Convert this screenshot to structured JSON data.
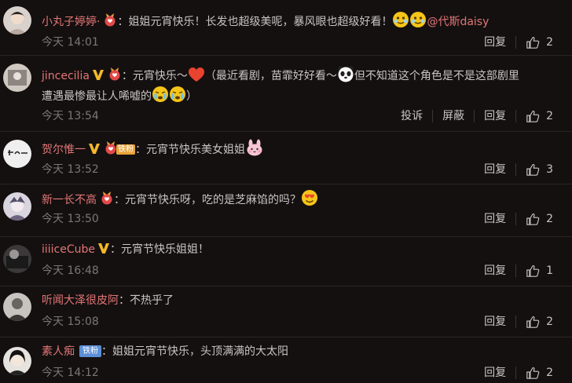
{
  "comments": [
    {
      "user": "小丸子婷婷·",
      "text": "：姐姐元宵快乐！长发也超级美呢，暴风眼也超级好看！",
      "mention": "@代斯daisy",
      "time": "今天 14:01",
      "reply": "回复",
      "likes": "2"
    },
    {
      "user": "jincecilia",
      "text_a": "：元宵快乐～",
      "text_b": "（最近看剧，苗霏好好看～",
      "text_c": "但不知道这个角色是不是这部剧里",
      "text_d": "遭遇最惨最让人唏嘘的",
      "text_e": "）",
      "time": "今天 13:54",
      "report": "投诉",
      "block": "屏蔽",
      "reply": "回复",
      "likes": "2"
    },
    {
      "user": "贺尔惟一",
      "fan_tag": "铁粉",
      "text": "：元宵节快乐美女姐姐",
      "time": "今天 13:52",
      "reply": "回复",
      "likes": "3"
    },
    {
      "user": "新一长不高",
      "text": "：元宵节快乐呀，吃的是芝麻馅的吗？",
      "time": "今天 13:50",
      "reply": "回复",
      "likes": "2"
    },
    {
      "user": "iiiiceCube",
      "text": "：元宵节快乐姐姐！",
      "time": "今天 16:48",
      "reply": "回复",
      "likes": "1"
    },
    {
      "user": "听闻大泽很皮阿",
      "text": "：不热乎了",
      "time": "今天 15:08",
      "reply": "回复",
      "likes": "2"
    },
    {
      "user": "素人痴",
      "fan_tag": "铁粉",
      "text": "：姐姐元宵节快乐，头顶满满的大太阳",
      "time": "今天 14:12",
      "reply": "回复",
      "likes": "2"
    }
  ],
  "colors": {
    "background": "#151010",
    "username": "#e27676",
    "text": "#c9c4c4",
    "time": "#7c7676"
  }
}
